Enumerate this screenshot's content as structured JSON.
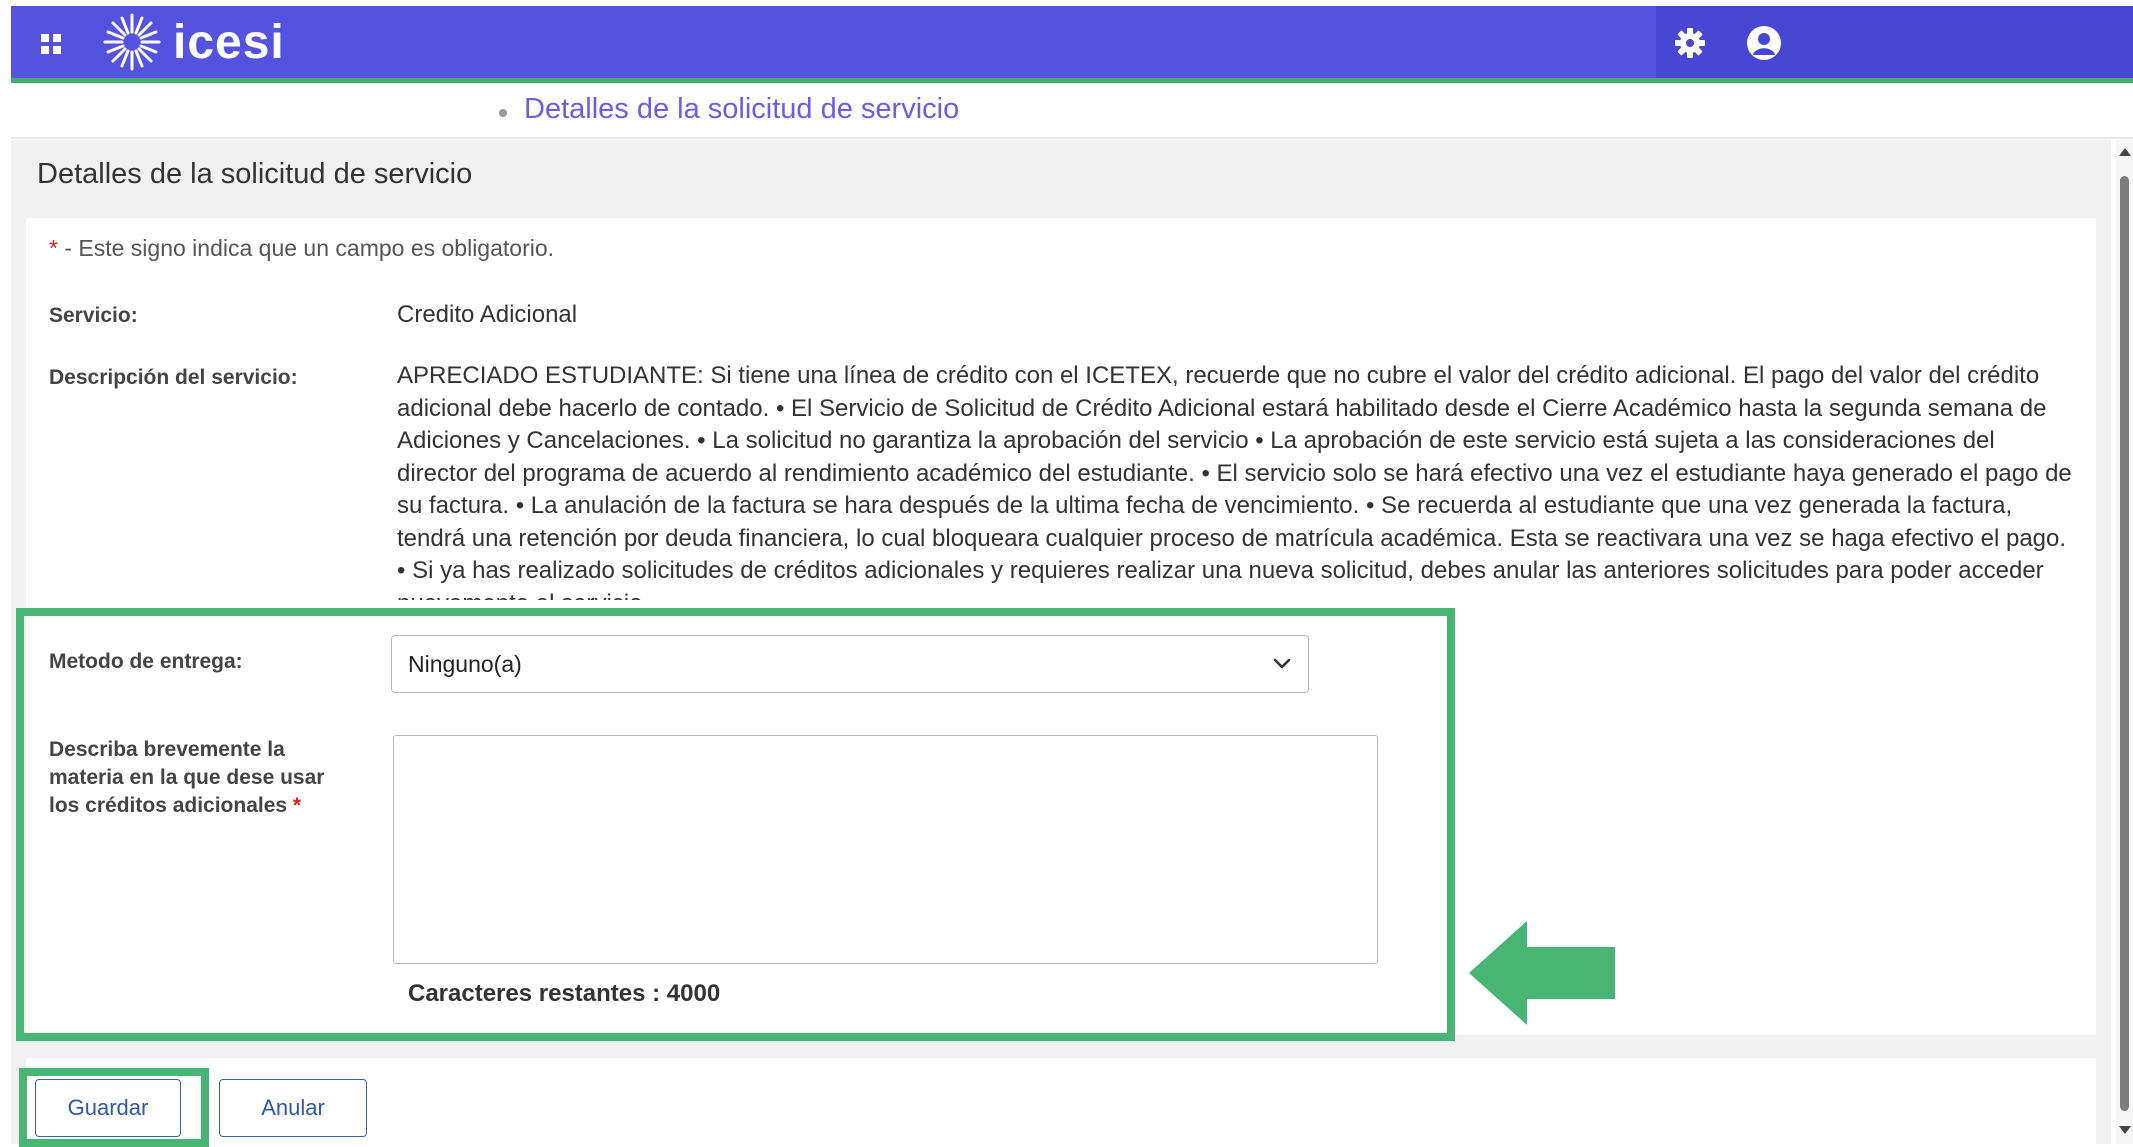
{
  "header": {
    "logo_text": "icesi",
    "brand_color": "#5353e0",
    "accent_color": "#3fae72",
    "icons": [
      "apps-grid-icon",
      "sun-logo-icon",
      "gear-icon",
      "user-icon"
    ]
  },
  "breadcrumb": {
    "current": "Detalles de la solicitud de servicio"
  },
  "page": {
    "title": "Detalles de la solicitud de servicio",
    "required_star": "*",
    "required_note": " - Este signo indica que un campo es obligatorio.",
    "service_label": "Servicio:",
    "service_value": "Credito Adicional",
    "description_label": "Descripción del servicio:",
    "description_text": "APRECIADO ESTUDIANTE: Si tiene una línea de crédito con el ICETEX, recuerde que no cubre el valor del crédito adicional. El pago del valor del crédito adicional debe hacerlo de contado. • El Servicio de Solicitud de Crédito Adicional estará habilitado desde el Cierre Académico hasta la segunda semana de Adiciones y Cancelaciones. • La solicitud no garantiza la aprobación del servicio • La aprobación de este servicio está sujeta a las consideraciones del director del programa de acuerdo al rendimiento académico del estudiante. • El servicio solo se hará efectivo una vez el estudiante haya generado el pago de su factura. • La anulación de la factura se hara después de la ultima fecha de vencimiento. • Se recuerda al estudiante que una vez generada la factura, tendrá una retención por deuda financiera, lo cual bloqueara cualquier proceso de matrícula académica. Esta se reactivara una vez se haga efectivo el pago. • Si ya has realizado solicitudes de créditos adicionales y requieres realizar una nueva solicitud, debes anular las anteriores solicitudes para poder acceder nuevamente al servicio.",
    "delivery_label": "Metodo de entrega:",
    "delivery_value": "Ninguno(a)",
    "subject_label": "Describa brevemente la materia en la que dese usar los créditos adicionales ",
    "subject_value": "",
    "chars_remaining": "Caracteres restantes : 4000"
  },
  "actions": {
    "save": "Guardar",
    "cancel": "Anular"
  },
  "annotations": {
    "highlight_color": "#49b575"
  }
}
